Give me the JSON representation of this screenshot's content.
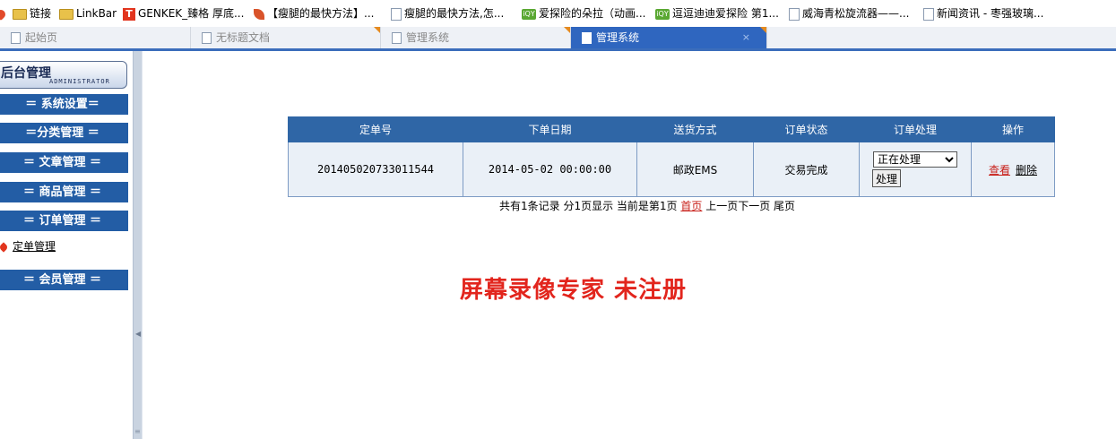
{
  "bookmarks": [
    {
      "label": "链接",
      "icon": "folder-icon"
    },
    {
      "label": "LinkBar",
      "icon": "folder-icon"
    },
    {
      "label": "GENKEK_臻格 厚底...",
      "icon": "t-logo-icon"
    },
    {
      "label": "【瘦腿的最快方法】...",
      "icon": "leaf-icon"
    },
    {
      "label": "瘦腿的最快方法,怎...",
      "icon": "page-icon"
    },
    {
      "label": "爱探险的朵拉（动画...",
      "icon": "iqiyi-icon"
    },
    {
      "label": "逗逗迪迪爱探险 第1...",
      "icon": "iqiyi-icon"
    },
    {
      "label": "威海青松旋流器——...",
      "icon": "page-icon"
    },
    {
      "label": "新闻资讯 - 枣强玻璃...",
      "icon": "page-icon"
    }
  ],
  "tabs": [
    {
      "label": "起始页",
      "active": false
    },
    {
      "label": "无标题文档",
      "active": false
    },
    {
      "label": "管理系统",
      "active": false
    },
    {
      "label": "管理系统",
      "active": true,
      "close": "×"
    }
  ],
  "sidebar": {
    "title": "后台管理",
    "subtitle": "ADMINISTRATOR",
    "menu": [
      "＝ 系统设置＝",
      "＝分类管理 ＝",
      "＝ 文章管理 ＝",
      "＝ 商品管理 ＝",
      "＝ 订单管理 ＝"
    ],
    "order_sub_item": "定单管理",
    "member_menu": "＝ 会员管理 ＝"
  },
  "table": {
    "headers": [
      "定单号",
      "下单日期",
      "送货方式",
      "订单状态",
      "订单处理",
      "操作"
    ],
    "row": {
      "order_no": "201405020733011544",
      "date": "2014-05-02 00:00:00",
      "shipping": "邮政EMS",
      "status": "交易完成",
      "select_value": "正在处理",
      "process_button": "处理",
      "view": "查看",
      "delete": "删除"
    }
  },
  "pager": {
    "summary": "共有1条记录  分1页显示  当前是第1页",
    "first": "首页",
    "rest": "上一页下一页 尾页"
  },
  "watermark": "屏幕录像专家  未注册",
  "colors": {
    "menu_bg": "#235da5",
    "table_header": "#2f66a6",
    "tab_active": "#2f66bf",
    "accent_red": "#e2251d"
  }
}
